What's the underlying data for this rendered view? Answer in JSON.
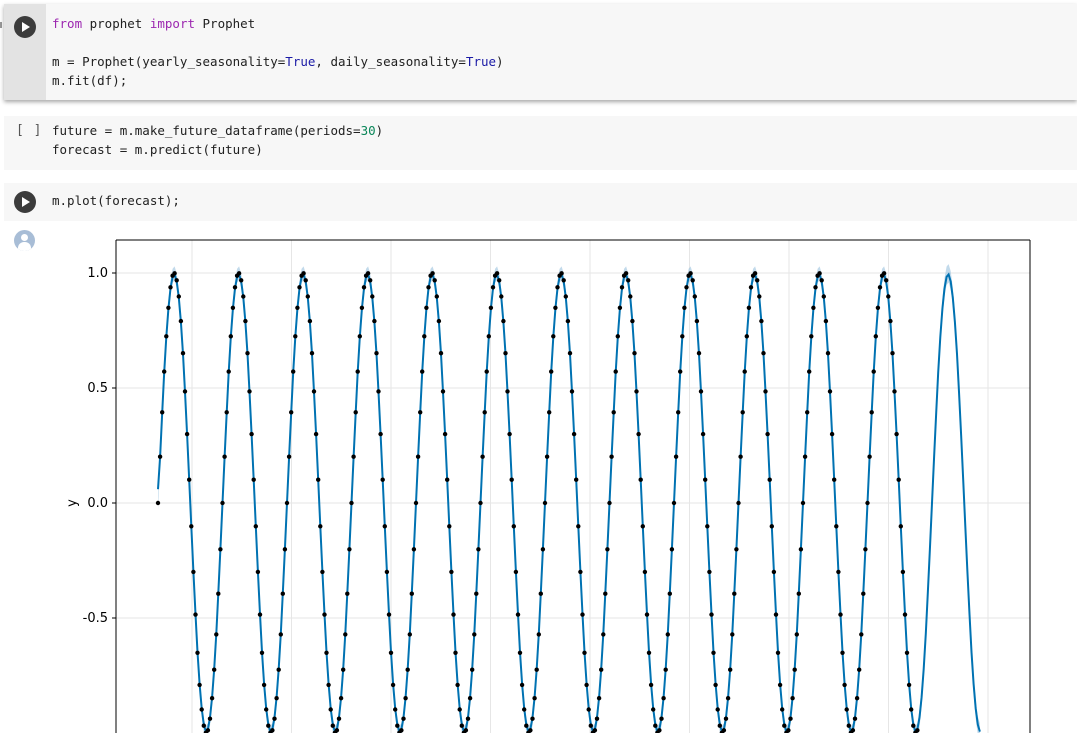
{
  "cells": [
    {
      "lines": [
        [
          {
            "t": "from",
            "c": "kw"
          },
          {
            "t": " prophet "
          },
          {
            "t": "import",
            "c": "kw"
          },
          {
            "t": " Prophet"
          }
        ],
        [],
        [
          {
            "t": "m = Prophet(yearly_seasonality="
          },
          {
            "t": "True",
            "c": "bool"
          },
          {
            "t": ", daily_seasonality="
          },
          {
            "t": "True",
            "c": "bool"
          },
          {
            "t": ")"
          }
        ],
        [
          {
            "t": "m.fit(df);"
          }
        ]
      ]
    },
    {
      "bracket": "[ ]",
      "lines": [
        [
          {
            "t": "future = m.make_future_dataframe(periods="
          },
          {
            "t": "30",
            "c": "num"
          },
          {
            "t": ")"
          }
        ],
        [
          {
            "t": "forecast = m.predict(future)"
          }
        ]
      ]
    },
    {
      "lines": [
        [
          {
            "t": "m.plot(forecast);"
          }
        ]
      ]
    }
  ],
  "output_icon": "user-avatar-icon",
  "colors": {
    "line": "#0072b2",
    "band": "#99c2dd",
    "points": "#000000",
    "grid": "#e6e6e6"
  },
  "chart_data": {
    "type": "line",
    "ylabel": "y",
    "yticks": [
      1.0,
      0.5,
      0.0,
      -0.5
    ],
    "ytick_labels": [
      "1.0",
      "0.5",
      "0.0",
      "-0.5"
    ],
    "ylim": [
      -0.97,
      1.14
    ],
    "grid": true,
    "series": [
      {
        "role": "observed",
        "style": "points",
        "rule": "y = sin(2*pi*t/period)",
        "period_per_cycle": 31,
        "count": 366
      },
      {
        "role": "forecast",
        "style": "line",
        "extends_beyond_observed": 30
      }
    ]
  }
}
